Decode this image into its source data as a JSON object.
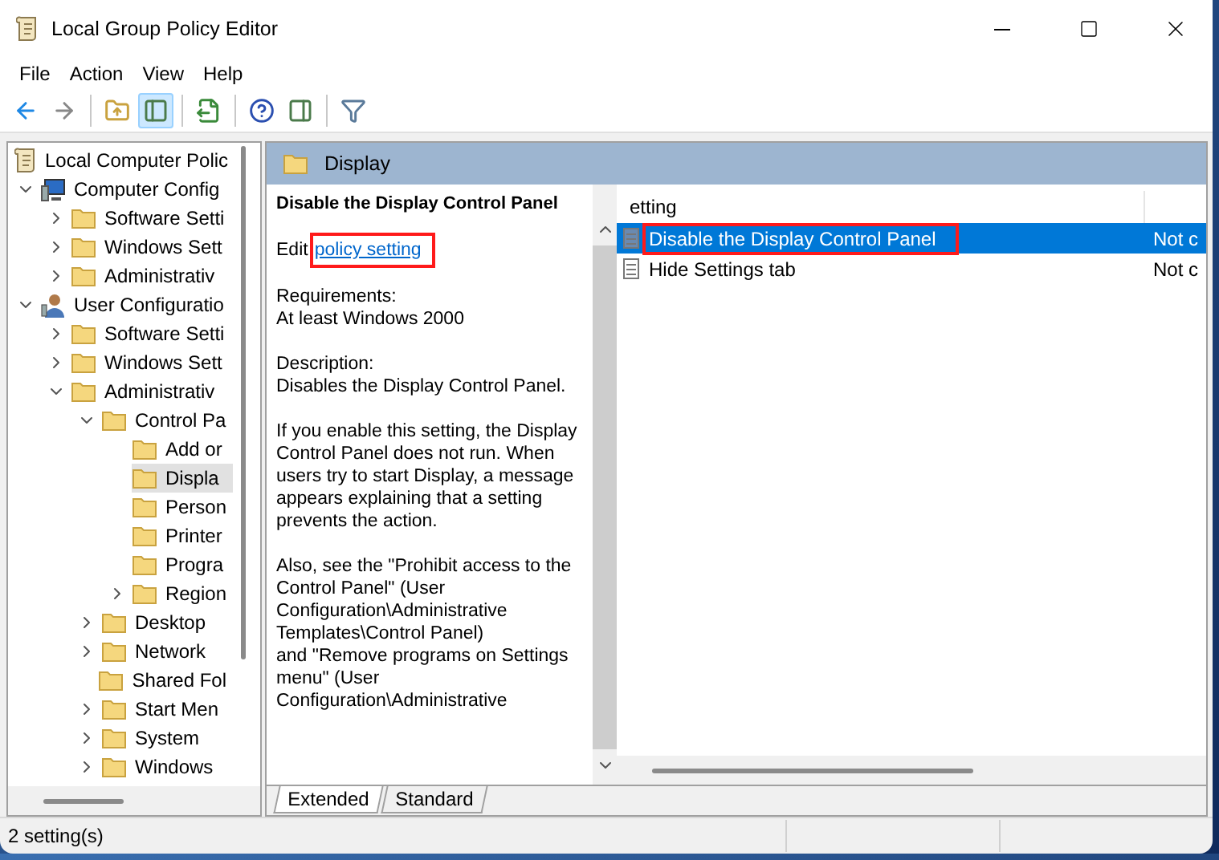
{
  "window": {
    "title": "Local Group Policy Editor"
  },
  "menu": [
    "File",
    "Action",
    "View",
    "Help"
  ],
  "toolbar": [
    {
      "disabled": false,
      "pressed": false
    },
    {
      "disabled": true,
      "pressed": false
    },
    {
      "disabled": false,
      "pressed": false
    },
    {
      "disabled": false,
      "pressed": true
    },
    {
      "disabled": false,
      "pressed": false
    },
    {
      "disabled": false,
      "pressed": false
    },
    {
      "disabled": false,
      "pressed": false
    },
    {
      "disabled": false,
      "pressed": false
    }
  ],
  "tree": [
    {
      "label": "Local Computer Polic",
      "kind": "scroll",
      "selected": false,
      "children": [
        {
          "label": "Computer Config",
          "kind": "computer",
          "expanded": true,
          "selected": false,
          "children": [
            {
              "label": "Software Setti",
              "kind": "folder",
              "expanded": false,
              "selected": false
            },
            {
              "label": "Windows Sett",
              "kind": "folder",
              "expanded": false,
              "selected": false
            },
            {
              "label": "Administrativ",
              "kind": "folder",
              "expanded": false,
              "selected": false
            }
          ]
        },
        {
          "label": "User Configuratio",
          "kind": "user",
          "expanded": true,
          "selected": false,
          "children": [
            {
              "label": "Software Setti",
              "kind": "folder",
              "expanded": false,
              "selected": false
            },
            {
              "label": "Windows Sett",
              "kind": "folder",
              "expanded": false,
              "selected": false
            },
            {
              "label": "Administrativ",
              "kind": "folder",
              "expanded": true,
              "selected": false,
              "children": [
                {
                  "label": "Control Pa",
                  "kind": "folder",
                  "expanded": true,
                  "selected": false,
                  "children": [
                    {
                      "label": "Add or",
                      "kind": "folder",
                      "selected": false
                    },
                    {
                      "label": "Displa",
                      "kind": "folder",
                      "selected": true
                    },
                    {
                      "label": "Person",
                      "kind": "folder",
                      "selected": false
                    },
                    {
                      "label": "Printer",
                      "kind": "folder",
                      "selected": false
                    },
                    {
                      "label": "Progra",
                      "kind": "folder",
                      "selected": false
                    },
                    {
                      "label": "Region",
                      "kind": "folder",
                      "expanded": false,
                      "selected": false
                    }
                  ]
                },
                {
                  "label": "Desktop",
                  "kind": "folder",
                  "expanded": false,
                  "selected": false
                },
                {
                  "label": "Network",
                  "kind": "folder",
                  "expanded": false,
                  "selected": false
                },
                {
                  "label": "Shared Fol",
                  "kind": "folder",
                  "selected": false
                },
                {
                  "label": "Start Men",
                  "kind": "folder",
                  "expanded": false,
                  "selected": false
                },
                {
                  "label": "System",
                  "kind": "folder",
                  "expanded": false,
                  "selected": false
                },
                {
                  "label": "Windows",
                  "kind": "folder",
                  "expanded": false,
                  "selected": false
                }
              ]
            }
          ]
        }
      ]
    }
  ],
  "header": {
    "title": "Display"
  },
  "description": {
    "title": "Disable the Display Control Panel",
    "edit_prefix": "Edit",
    "edit_link": "policy setting",
    "link_highlighted": true,
    "paragraphs": [
      [
        "Requirements:",
        "At least Windows 2000"
      ],
      [
        "Description:",
        "Disables the Display Control Panel."
      ],
      [
        "If you enable this setting, the Display Control Panel does not run. When users try to start Display, a message appears explaining that a setting prevents the action."
      ],
      [
        "Also, see the \"Prohibit access to the Control Panel\" (User Configuration\\Administrative Templates\\Control Panel)",
        "and \"Remove programs on Settings menu\" (User Configuration\\Administrative"
      ]
    ]
  },
  "list": {
    "columns": [
      "etting"
    ],
    "rows": [
      {
        "name": "Disable the Display Control Panel",
        "state": "Not c",
        "selected": true,
        "highlighted": true
      },
      {
        "name": "Hide Settings tab",
        "state": "Not c",
        "selected": false,
        "highlighted": false
      }
    ]
  },
  "view_tabs": [
    {
      "label": "Extended",
      "selected": true
    },
    {
      "label": "Standard",
      "selected": false
    }
  ],
  "status_bar": "2 setting(s)"
}
